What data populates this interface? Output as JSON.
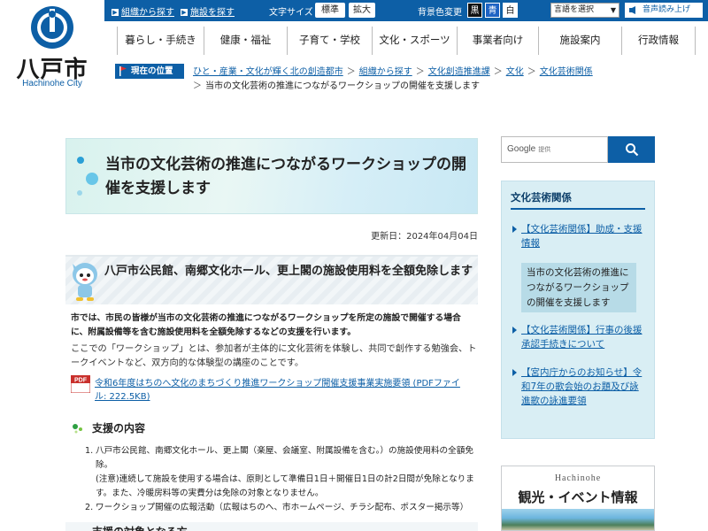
{
  "logo": {
    "title": "八戸市",
    "subtitle": "Hachinohe City"
  },
  "topbar": {
    "find_by_org": "組織から探す",
    "find_facility": "施設を探す",
    "font_size_label": "文字サイズ",
    "font_standard": "標準",
    "font_enlarge": "拡大",
    "bg_color_label": "背景色変更",
    "bg_black": "黒",
    "bg_blue": "青",
    "bg_white": "白",
    "language_select": "言語を選択",
    "read_aloud": "音声読み上げ"
  },
  "nav": [
    "暮らし・手続き",
    "健康・福祉",
    "子育て・学校",
    "文化・スポーツ",
    "事業者向け",
    "施設案内",
    "行政情報"
  ],
  "breadcrumb": {
    "label": "現在の位置",
    "items": [
      "ひと・産業・文化が輝く北の創造都市",
      "組織から探す",
      "文化創造推進課",
      "文化",
      "文化芸術関係"
    ],
    "current": "当市の文化芸術の推進につながるワークショップの開催を支援します"
  },
  "page": {
    "title": "当市の文化芸術の推進につながるワークショップの開催を支援します",
    "updated": "更新日：2024年04月04日",
    "section1_title": "八戸市公民館、南郷文化ホール、更上閣の施設使用料を全額免除します",
    "lead_bold": "市では、市民の皆様が当市の文化芸術の推進につながるワークショップを所定の施設で開催する場合に、附属設備等を含む施設使用料を全額免除するなどの支援を行います。",
    "lead_normal": "ここでの「ワークショップ」とは、参加者が主体的に文化芸術を体験し、共同で創作する勉強会、トークイベントなど、双方向的な体験型の講座のことです。",
    "pdf_link": "令和6年度はちのへ文化のまちづくり推進ワークショップ開催支援事業実施要領 (PDFファイル: 222.5KB)",
    "pdf_label": "PDF",
    "section2_title": "支援の内容",
    "list": [
      {
        "num": "1.",
        "text": "八戸市公民館、南郷文化ホール、更上閣（楽屋、会議室、附属設備を含む。）の施設使用料の全額免除。",
        "note": "(注意)連続して施設を使用する場合は、原則として準備日1日＋開催日1日の計2日間が免除となります。また、冷暖房料等の実費分は免除の対象となりません。"
      },
      {
        "num": "2.",
        "text": "ワークショップ開催の広報活動（広報はちのへ、市ホームページ、チラシ配布、ポスター掲示等）"
      }
    ],
    "section3_title": "支援の対象となる方"
  },
  "search": {
    "brand": "Google",
    "provided": "提供"
  },
  "sidebar": {
    "title": "文化芸術関係",
    "items": [
      "【文化芸術関係】助成・支援情報",
      "当市の文化芸術の推進につながるワークショップの開催を支援します",
      "【文化芸術関係】行事の後援承認手続きについて",
      "【宮内庁からのお知らせ】令和7年の歌会始のお題及び詠進歌の詠進要領"
    ]
  },
  "banner": {
    "top": "Hachinohe",
    "main": "観光・イベント情報"
  },
  "colors": {
    "brand_blue": "#0d5fa6",
    "side_bg": "#d9eef4"
  }
}
